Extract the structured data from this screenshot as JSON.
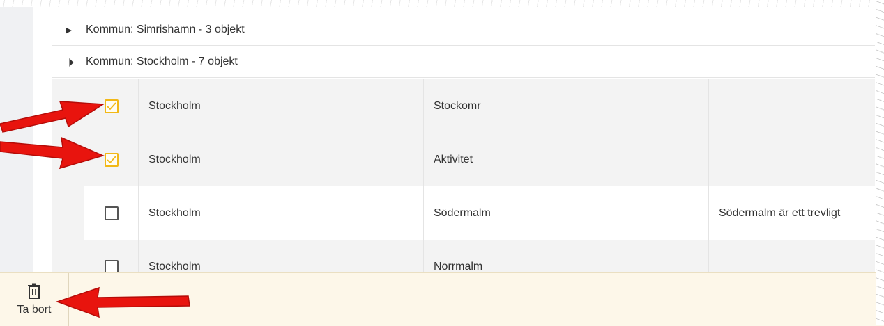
{
  "groups": [
    {
      "label": "Kommun: Simrishamn - 3 objekt",
      "expanded": false
    },
    {
      "label": "Kommun: Stockholm - 7 objekt",
      "expanded": true
    }
  ],
  "rows": [
    {
      "checked": true,
      "col1": "Stockholm",
      "col2": "Stockomr",
      "col3": ""
    },
    {
      "checked": true,
      "col1": "Stockholm",
      "col2": "Aktivitet",
      "col3": ""
    },
    {
      "checked": false,
      "col1": "Stockholm",
      "col2": "Södermalm",
      "col3": "Södermalm är ett trevligt"
    },
    {
      "checked": false,
      "col1": "Stockholm",
      "col2": "Norrmalm",
      "col3": ""
    }
  ],
  "toolbar": {
    "delete_label": "Ta bort"
  },
  "colors": {
    "accent_check": "#f2b816",
    "toolbar_bg": "#fdf7e9",
    "arrow": "#e8140e"
  },
  "icons": {
    "collapsed": "caret-right-icon",
    "expanded": "caret-down-icon",
    "delete": "trash-icon"
  }
}
